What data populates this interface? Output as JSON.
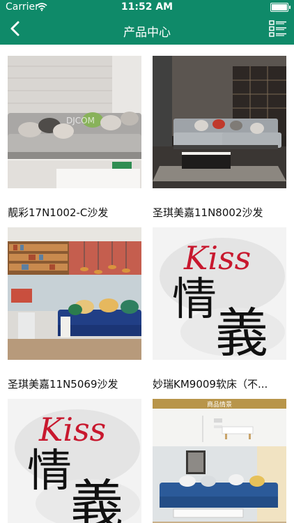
{
  "status": {
    "carrier": "Carrier",
    "time": "11:52 AM"
  },
  "nav": {
    "title": "产品中心",
    "back_icon": "chevron-left-icon",
    "menu_icon": "list-menu-icon"
  },
  "colors": {
    "header_bg": "#0f8a69",
    "header_text": "#ffffff",
    "text": "#111111",
    "kiss_red": "#c8182e"
  },
  "products": [
    {
      "name": "靓彩17N1002-C沙发",
      "image": "gray-sofa-photo"
    },
    {
      "name": "圣琪美嘉11N8002沙发",
      "image": "sectional-sofa-living-room-photo"
    },
    {
      "name": "圣琪美嘉11N5069沙发",
      "image": "blue-sofa-shelves-photo"
    },
    {
      "name": "妙瑞KM9009软床（不...",
      "image": "kiss-qingyi-calligraphy-image"
    },
    {
      "name": "",
      "image": "kiss-qingyi-calligraphy-image"
    },
    {
      "name": "",
      "image": "product-details-blue-sofa-image"
    }
  ],
  "image_text": {
    "watermark": "DJCOM",
    "kiss": "Kiss",
    "qing": "情",
    "yi": "義",
    "details_banner": "商品情景"
  }
}
